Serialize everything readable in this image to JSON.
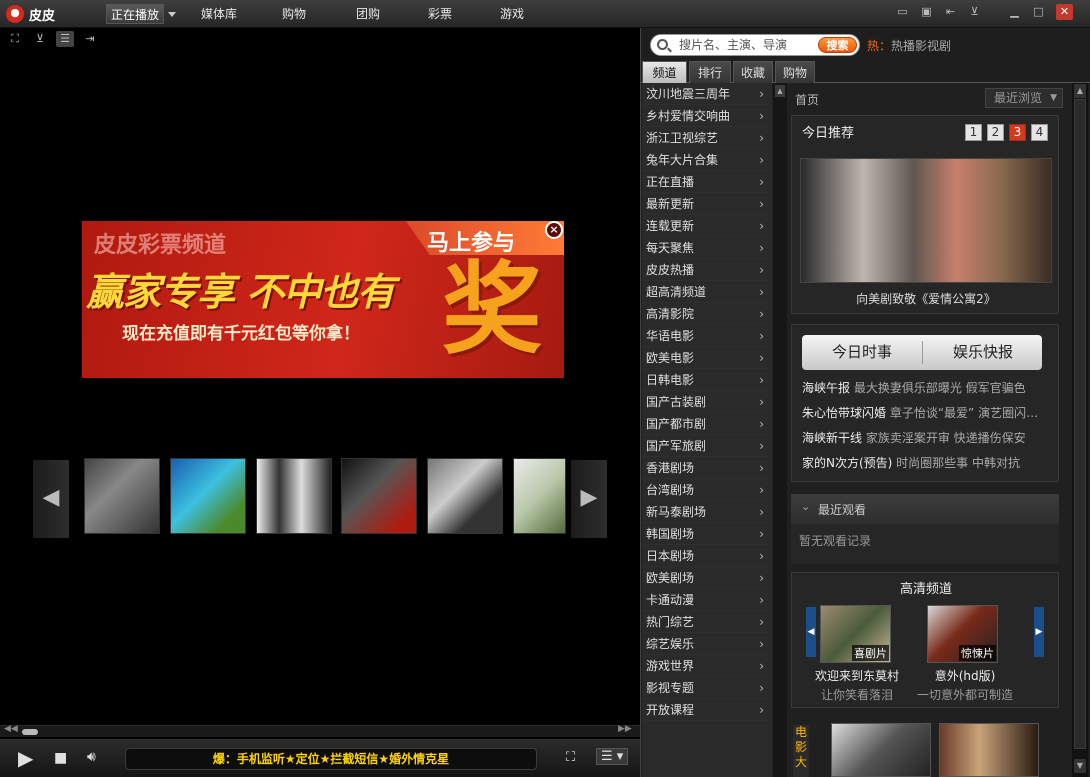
{
  "app": {
    "title": "皮皮"
  },
  "top_tabs": [
    {
      "label": "正在播放"
    },
    {
      "label": "媒体库"
    },
    {
      "label": "购物"
    },
    {
      "label": "团购"
    },
    {
      "label": "彩票"
    },
    {
      "label": "游戏"
    }
  ],
  "ad": {
    "brand": "皮皮彩票频道",
    "join": "马上参与",
    "slogan": "赢家专享 不中也有",
    "sub": "现在充值即有千元红包等你拿！",
    "big": "奖",
    "close": "×"
  },
  "player": {
    "marquee": "爆：手机监听★定位★拦截短信★婚外情克星"
  },
  "search": {
    "placeholder": "搜片名、主演、导演",
    "button": "搜索",
    "hot_label": "热：",
    "hot_text": "热播影视剧"
  },
  "right_tabs": [
    {
      "label": "频道"
    },
    {
      "label": "排行"
    },
    {
      "label": "收藏"
    },
    {
      "label": "购物"
    }
  ],
  "channels": [
    "汶川地震三周年",
    "乡村爱情交响曲",
    "浙江卫视综艺",
    "兔年大片合集",
    "正在直播",
    "最新更新",
    "连载更新",
    "每天聚焦",
    "皮皮热播",
    "超高清频道",
    "高清影院",
    "华语电影",
    "欧美电影",
    "日韩电影",
    "国产古装剧",
    "国产都市剧",
    "国产军旅剧",
    "香港剧场",
    "台湾剧场",
    "新马泰剧场",
    "韩国剧场",
    "日本剧场",
    "欧美剧场",
    "卡通动漫",
    "热门综艺",
    "综艺娱乐",
    "游戏世界",
    "影视专题",
    "开放课程"
  ],
  "content": {
    "breadcrumb": "首页",
    "recent_select": "最近浏览",
    "today": {
      "title": "今日推荐",
      "pages": [
        "1",
        "2",
        "3",
        "4"
      ],
      "active_page": 3,
      "caption": "向美剧致敬《爱情公寓2》"
    },
    "news": {
      "tab1": "今日时事",
      "tab2": "娱乐快报",
      "lines": [
        {
          "head": "海峡午报",
          "rest": "最大换妻俱乐部曝光 假军官骗色"
        },
        {
          "head": "朱心怡带球闪婚",
          "rest": "章子怡谈“最爱” 演艺圈闪…"
        },
        {
          "head": "海峡新干线",
          "rest": "家族卖淫案开审 快递播伤保安"
        },
        {
          "head": "家的N次方(预告)",
          "rest": "时尚圈那些事 中韩对抗"
        }
      ]
    },
    "recent": {
      "title": "最近观看",
      "empty": "暂无观看记录"
    },
    "hd": {
      "title": "高清频道",
      "items": [
        {
          "badge": "喜剧片",
          "name": "欢迎来到东莫村",
          "desc": "让你笑看落泪"
        },
        {
          "badge": "惊悚片",
          "name": "意外(hd版)",
          "desc": "一切意外都可制造"
        }
      ]
    },
    "movie_label": "电影大"
  }
}
